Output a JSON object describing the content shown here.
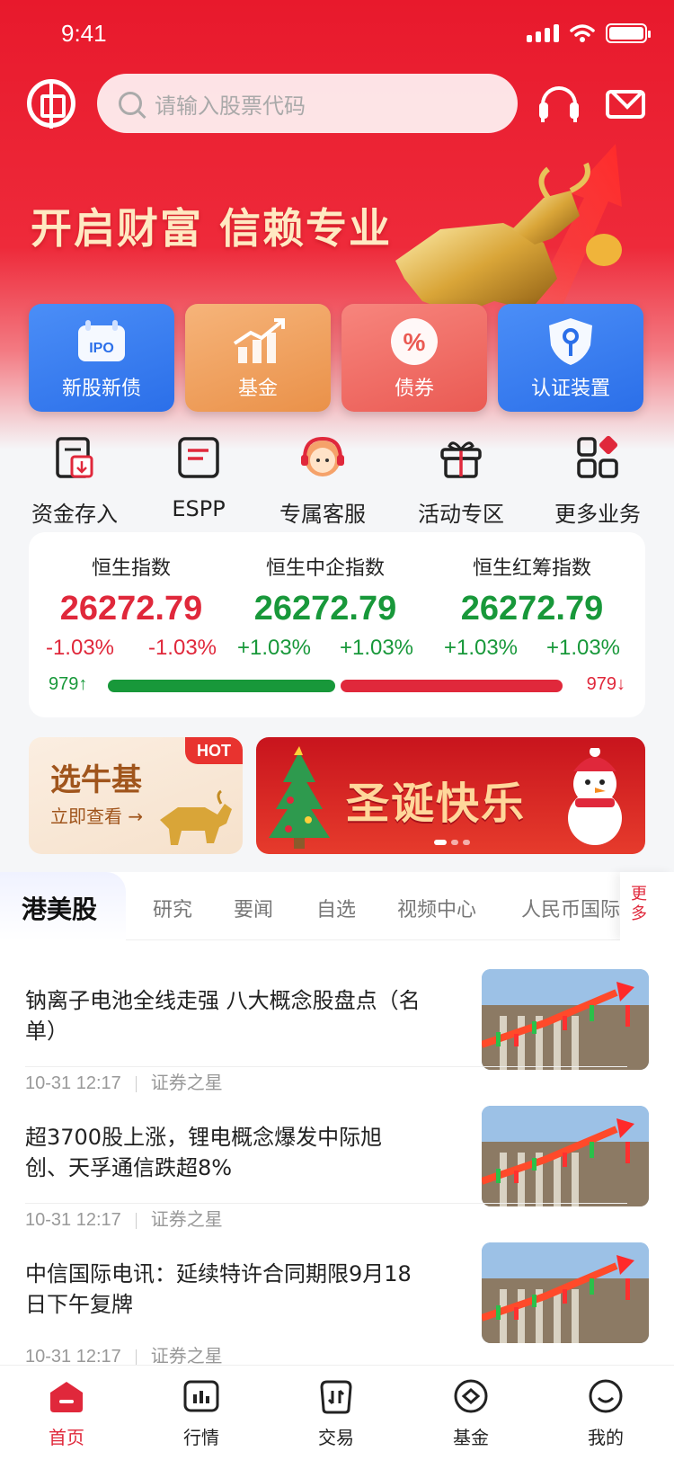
{
  "status_bar": {
    "time": "9:41"
  },
  "search": {
    "placeholder": "请输入股票代码"
  },
  "hero": {
    "slogan": "开启财富 信赖专业"
  },
  "quick_actions": [
    {
      "label": "新股新债",
      "icon": "ipo-calendar-icon"
    },
    {
      "label": "基金",
      "icon": "bar-chart-up-icon"
    },
    {
      "label": "债券",
      "icon": "percent-badge-icon"
    },
    {
      "label": "认证装置",
      "icon": "key-shield-icon"
    }
  ],
  "services": [
    {
      "label": "资金存入",
      "icon": "deposit-icon"
    },
    {
      "label": "ESPP",
      "icon": "espp-icon"
    },
    {
      "label": "专属客服",
      "icon": "customer-service-icon"
    },
    {
      "label": "活动专区",
      "icon": "gift-icon"
    },
    {
      "label": "更多业务",
      "icon": "more-grid-icon"
    }
  ],
  "indices": [
    {
      "name": "恒生指数",
      "value": "26272.79",
      "change1": "-1.03%",
      "change2": "-1.03%",
      "trend": "down"
    },
    {
      "name": "恒生中企指数",
      "value": "26272.79",
      "change1": "+1.03%",
      "change2": "+1.03%",
      "trend": "up"
    },
    {
      "name": "恒生红筹指数",
      "value": "26272.79",
      "change1": "+1.03%",
      "change2": "+1.03%",
      "trend": "up"
    }
  ],
  "breadth": {
    "up_count": "979",
    "down_count": "979",
    "up_fraction": 0.5
  },
  "banners": {
    "bull_fund": {
      "title": "选牛基",
      "subtitle": "立即查看 →",
      "badge": "HOT"
    },
    "xmas": {
      "title": "圣诞快乐"
    }
  },
  "tabs": {
    "active": "港美股",
    "items": [
      "研究",
      "要闻",
      "自选",
      "视频中心",
      "人民币国际"
    ],
    "more": "更多"
  },
  "news": [
    {
      "title": "钠离子电池全线走强 八大概念股盘点（名单）",
      "time": "10-31 12:17",
      "source": "证券之星"
    },
    {
      "title": "超3700股上涨，锂电概念爆发中际旭创、天孚通信跌超8%",
      "time": "10-31 12:17",
      "source": "证券之星"
    },
    {
      "title": "中信国际电讯：延续特许合同期限9月18日下午复牌",
      "time": "10-31 12:17",
      "source": "证券之星"
    }
  ],
  "tabbar": [
    {
      "label": "首页",
      "active": true
    },
    {
      "label": "行情",
      "active": false
    },
    {
      "label": "交易",
      "active": false
    },
    {
      "label": "基金",
      "active": false
    },
    {
      "label": "我的",
      "active": false
    }
  ],
  "colors": {
    "brand_red": "#e8192c",
    "up_green": "#18983a",
    "down_red": "#e0283b"
  }
}
